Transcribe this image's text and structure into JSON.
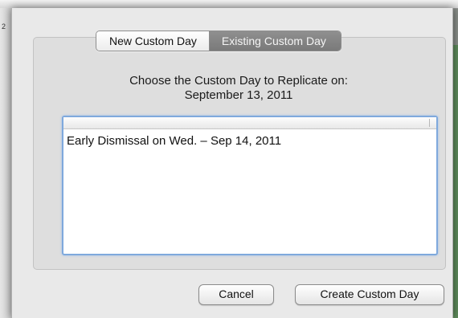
{
  "window": {
    "row_number": "2"
  },
  "tabs": [
    {
      "label": "New Custom Day",
      "selected": false
    },
    {
      "label": "Existing Custom Day",
      "selected": true
    }
  ],
  "prompt": {
    "line1": "Choose the Custom Day to Replicate on:",
    "line2": "September 13, 2011"
  },
  "custom_days": [
    "Early Dismissal on Wed. – Sep 14, 2011"
  ],
  "buttons": {
    "cancel": "Cancel",
    "create": "Create Custom Day"
  },
  "colors": {
    "selected_tab": "#858585",
    "focus_ring": "#7fa9dd",
    "background_calendar": "#5f8c5c"
  }
}
